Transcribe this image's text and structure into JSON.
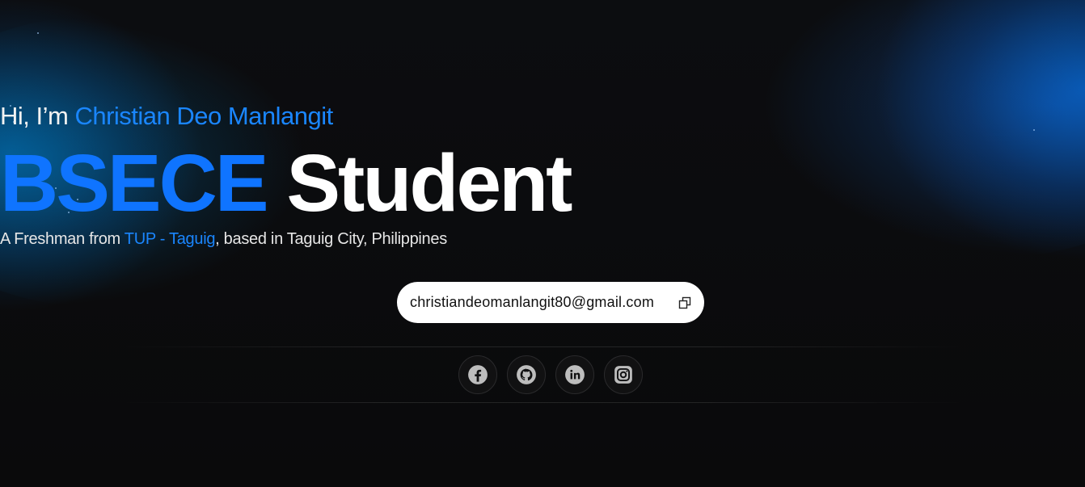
{
  "hero": {
    "greeting_prefix": "Hi, I’m ",
    "name": "Christian Deo Manlangit",
    "headline_accent": "BSECE",
    "headline_rest": " Student",
    "sub_prefix": "A Freshman from ",
    "school": "TUP - Taguig",
    "sub_suffix": ", based in Taguig City, Philippines"
  },
  "contact": {
    "email": "christiandeomanlangit80@gmail.com",
    "copy_icon": "copy-icon"
  },
  "socials": [
    {
      "name": "facebook",
      "icon": "facebook-icon"
    },
    {
      "name": "github",
      "icon": "github-icon"
    },
    {
      "name": "linkedin",
      "icon": "linkedin-icon"
    },
    {
      "name": "instagram",
      "icon": "instagram-icon"
    }
  ],
  "colors": {
    "background": "#0a0a0b",
    "accent": "#1a86ff",
    "text": "#ffffff",
    "icon": "#bdbdbd"
  }
}
